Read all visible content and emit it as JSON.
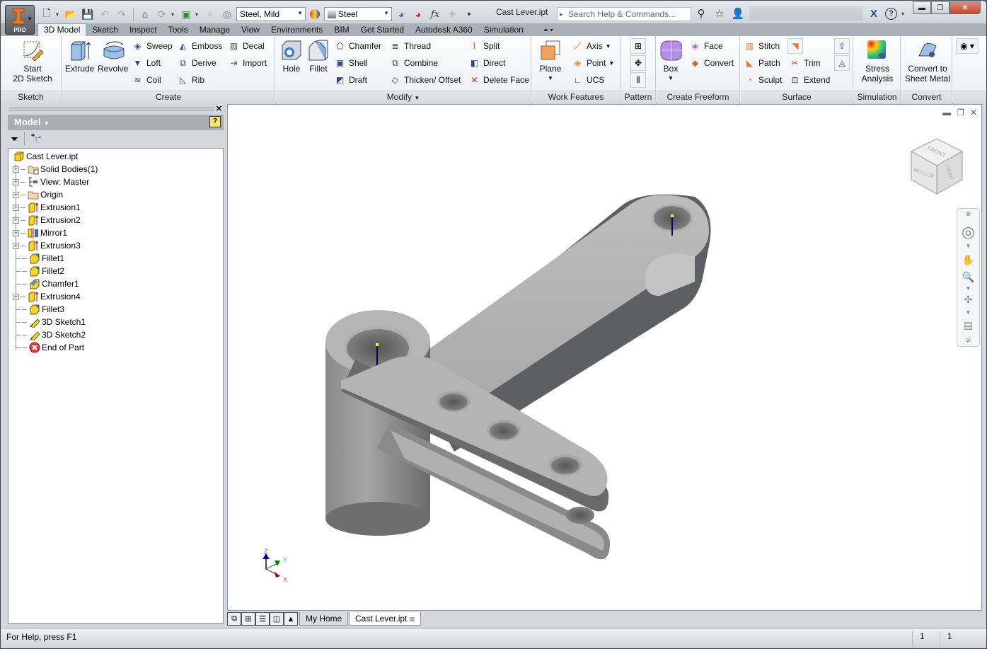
{
  "app": {
    "title": "Cast Lever.ipt",
    "edition_badge": "PRO",
    "search_placeholder": "Search Help & Commands...",
    "window_controls": [
      "minimize",
      "restore",
      "close"
    ]
  },
  "quick_access": {
    "material_value": "Steel, Mild",
    "appearance_value": "Steel",
    "icons": [
      "new-icon",
      "open-icon",
      "save-icon",
      "undo-icon",
      "redo-icon",
      "home-icon",
      "update-icon",
      "select-icon",
      "ipart-icon",
      "material-browser-icon",
      "color-wheel-icon",
      "adjust-appearance-icon",
      "clear-appearance-icon",
      "fx-parameters-icon",
      "measure-icon",
      "customize-icon"
    ]
  },
  "ribbon_tabs": [
    "3D Model",
    "Sketch",
    "Inspect",
    "Tools",
    "Manage",
    "View",
    "Environments",
    "BIM",
    "Get Started",
    "Autodesk A360",
    "Simulation"
  ],
  "active_tab": "3D Model",
  "ribbon": {
    "sketch": {
      "title": "Sketch",
      "start_line1": "Start",
      "start_line2": "2D Sketch"
    },
    "create": {
      "title": "Create",
      "extrude": "Extrude",
      "revolve": "Revolve",
      "sweep": "Sweep",
      "loft": "Loft",
      "coil": "Coil",
      "emboss": "Emboss",
      "derive": "Derive",
      "rib": "Rib",
      "decal": "Decal",
      "import": "Import"
    },
    "modify": {
      "title": "Modify",
      "hole": "Hole",
      "fillet": "Fillet",
      "chamfer": "Chamfer",
      "shell": "Shell",
      "draft": "Draft",
      "thread": "Thread",
      "combine": "Combine",
      "thicken": "Thicken/ Offset",
      "split": "Split",
      "direct": "Direct",
      "delete_face": "Delete Face"
    },
    "work_features": {
      "title": "Work Features",
      "plane": "Plane",
      "axis": "Axis",
      "point": "Point",
      "ucs": "UCS"
    },
    "pattern": {
      "title": "Pattern"
    },
    "freeform": {
      "title": "Create Freeform",
      "box": "Box",
      "face": "Face",
      "convert": "Convert"
    },
    "surface": {
      "title": "Surface",
      "stitch": "Stitch",
      "patch": "Patch",
      "sculpt": "Sculpt",
      "trim": "Trim",
      "extend": "Extend"
    },
    "simulation": {
      "title": "Simulation",
      "line1": "Stress",
      "line2": "Analysis"
    },
    "convert": {
      "title": "Convert",
      "line1": "Convert to",
      "line2": "Sheet Metal"
    }
  },
  "browser": {
    "title": "Model",
    "root": "Cast Lever.ipt",
    "nodes": [
      {
        "label": "Solid Bodies(1)",
        "icon": "solid-bodies-icon",
        "expandable": true
      },
      {
        "label": "View: Master",
        "icon": "view-rep-icon",
        "expandable": true
      },
      {
        "label": "Origin",
        "icon": "folder-icon",
        "expandable": true
      },
      {
        "label": "Extrusion1",
        "icon": "extrusion-icon",
        "expandable": true
      },
      {
        "label": "Extrusion2",
        "icon": "extrusion-icon",
        "expandable": true
      },
      {
        "label": "Mirror1",
        "icon": "mirror-icon",
        "expandable": true
      },
      {
        "label": "Extrusion3",
        "icon": "extrusion-icon",
        "expandable": true
      },
      {
        "label": "Fillet1",
        "icon": "fillet-icon",
        "expandable": false
      },
      {
        "label": "Fillet2",
        "icon": "fillet-icon",
        "expandable": false
      },
      {
        "label": "Chamfer1",
        "icon": "chamfer-icon",
        "expandable": false
      },
      {
        "label": "Extrusion4",
        "icon": "extrusion-icon",
        "expandable": true
      },
      {
        "label": "Fillet3",
        "icon": "fillet-icon",
        "expandable": false
      },
      {
        "label": "3D Sketch1",
        "icon": "sketch3d-icon",
        "expandable": false
      },
      {
        "label": "3D Sketch2",
        "icon": "sketch3d-icon",
        "expandable": false
      },
      {
        "label": "End of Part",
        "icon": "end-of-part-icon",
        "expandable": false
      }
    ]
  },
  "viewcube": {
    "faces": [
      "FRONT",
      "RIGHT",
      "BOTTOM"
    ]
  },
  "triad": {
    "x": "X",
    "y": "Y",
    "z": "Z"
  },
  "doc_tabs": [
    "My Home",
    "Cast Lever.ipt"
  ],
  "active_doc_tab": "Cast Lever.ipt",
  "status": {
    "message": "For Help, press F1",
    "count1": "1",
    "count2": "1"
  },
  "colors": {
    "accent_orange": "#e07a2a",
    "model_gray": "#a8a8a8",
    "viewport_bg": "#ffffff"
  }
}
